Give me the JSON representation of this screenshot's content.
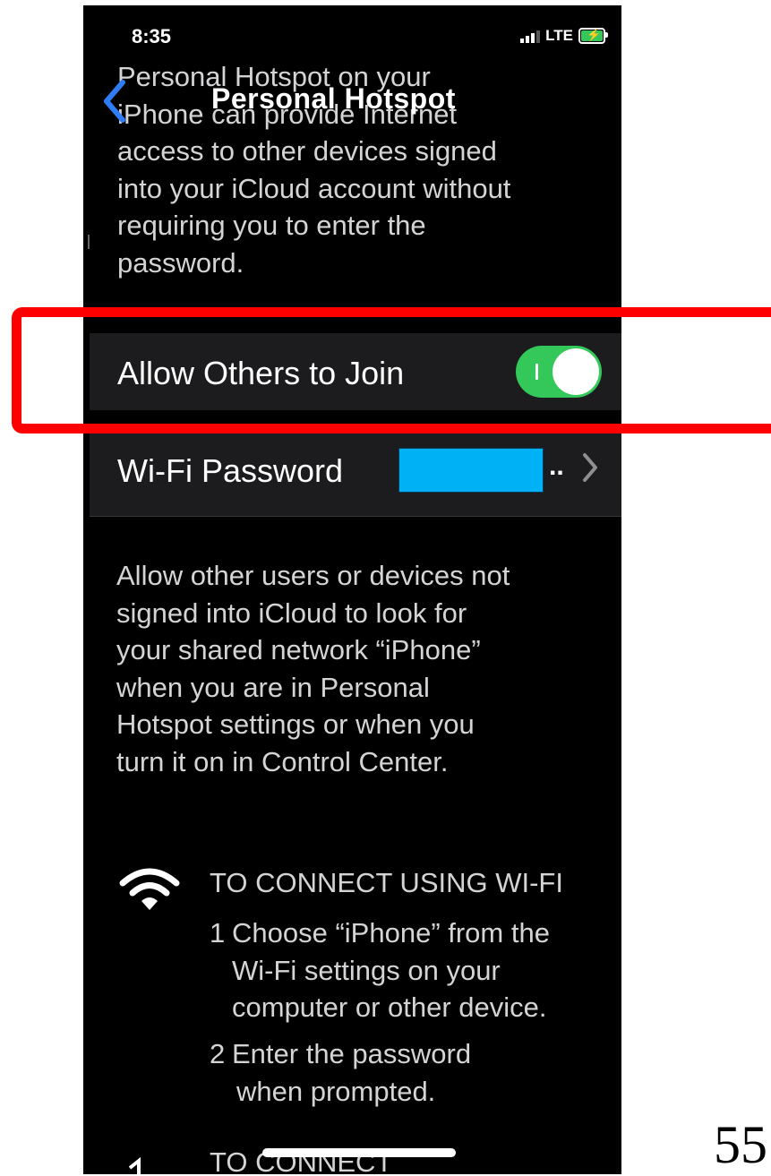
{
  "status_bar": {
    "time": "8:35",
    "network": "LTE"
  },
  "nav": {
    "title": "Personal Hotspot"
  },
  "intro_text": [
    "Personal Hotspot on your",
    "iPhone can provide Internet",
    "access to other devices signed",
    "into your iCloud account without",
    "requiring you to enter the",
    "password."
  ],
  "settings": {
    "allow_others": {
      "label": "Allow Others to Join",
      "enabled": true
    },
    "wifi_password": {
      "label": "Wi-Fi Password",
      "value_suffix": ".."
    }
  },
  "footer_text": [
    "Allow other users or devices not",
    "signed into iCloud to look for",
    "your shared network “iPhone”",
    "when you are in Personal",
    "Hotspot settings or when you",
    "turn it on in Control Center."
  ],
  "wifi_instructions": {
    "header": "TO CONNECT USING WI-FI",
    "steps": [
      {
        "number": "1",
        "lines": [
          "Choose “iPhone” from the",
          "Wi-Fi settings on your",
          "computer or other device."
        ]
      },
      {
        "number": "2",
        "lines": [
          "Enter the password",
          "when prompted."
        ]
      }
    ]
  },
  "next_section_header": "TO CONNECT",
  "page_number": "55",
  "colors": {
    "toggle_on": "#34c759",
    "back_chevron": "#2f7df6",
    "highlight": "#ff0000",
    "redaction": "#00b2f5"
  }
}
